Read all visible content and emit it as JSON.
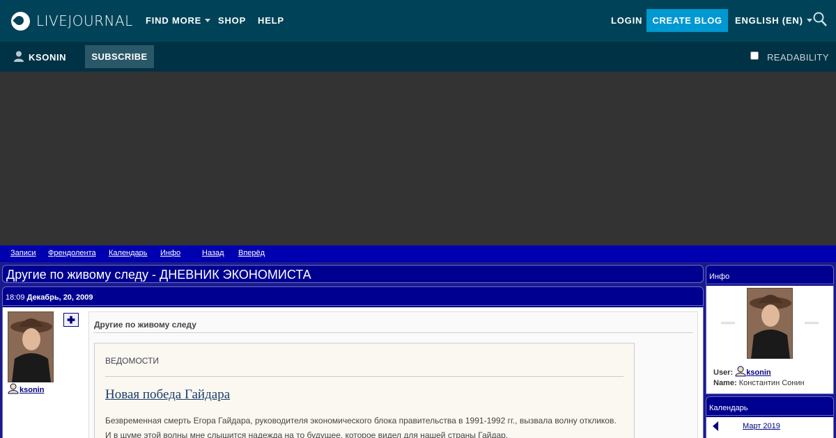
{
  "header": {
    "logo_text": "LIVEJOURNAL",
    "nav": {
      "find_more": "FIND MORE",
      "shop": "SHOP",
      "help": "HELP"
    },
    "login": "LOGIN",
    "create_blog": "CREATE BLOG",
    "language": "ENGLISH (EN)"
  },
  "subbar": {
    "username": "KSONIN",
    "subscribe": "SUBSCRIBE",
    "readability": "READABILITY"
  },
  "journal_nav": {
    "entries": "Записи",
    "friends": "Френдолента",
    "calendar": "Календарь",
    "info": "Инфо",
    "back": " Назад",
    "forward": "Вперёд "
  },
  "page": {
    "title": "Другие по живому следу - ДНЕВНИК ЭКОНОМИСТА"
  },
  "entry": {
    "time": "18:09",
    "date": "Декабрь, 20, 2009",
    "username": "ksonin",
    "subject": "Другие по живому следу",
    "source_alt": "ВЕДОМОСТИ",
    "article_title": "Новая победа Гайдара",
    "paragraph_1": "Безвременная смерть Егора Гайдара, руководителя экономического блока правительства в 1991-1992 гг., вызвала волну откликов.",
    "paragraph_2": "И в шуме этой волны мне слышится надежда на то будущее, которое видел для нашей страны Гайдар."
  },
  "sidebar": {
    "info_title": "Инфо",
    "user_label": "User:",
    "user_value": "ksonin",
    "name_label": "Name:",
    "name_value": "Константин Сонин",
    "calendar_title": "Календарь",
    "calendar_month": "Март 2019"
  },
  "colors": {
    "topbar": "#004359",
    "subbar": "#003245",
    "create_button": "#0098d1",
    "journal_blue": "#000090"
  }
}
